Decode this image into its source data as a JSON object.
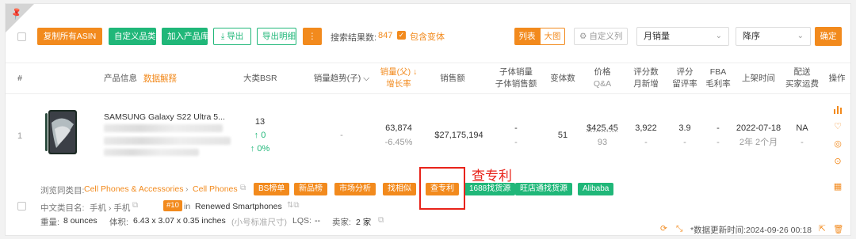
{
  "toolbar": {
    "copy_asin": "复制所有ASIN",
    "custom_category": "自定义品类",
    "add_to_library": "加入产品库",
    "export": "导出",
    "export_detail": "导出明细",
    "more": "⋮",
    "result_label": "搜索结果数:",
    "result_count": "847",
    "include_variants": "包含变体",
    "view_list": "列表",
    "view_grid": "大图",
    "custom_columns": "自定义列",
    "sort_field": "月销量",
    "sort_order": "降序",
    "confirm": "确定"
  },
  "headers": {
    "index": "#",
    "product_info": "产品信息",
    "data_explain": "数据解释",
    "bsr": "大类BSR",
    "sales_trend": "销量趋势(子)",
    "sales_parent_1": "销量(父)",
    "sales_parent_2": "增长率",
    "revenue": "销售额",
    "child_sales_1": "子体销量",
    "child_sales_2": "子体销售额",
    "variants": "变体数",
    "price_1": "价格",
    "price_2": "Q&A",
    "reviews_1": "评分数",
    "reviews_2": "月新增",
    "rating_1": "评分",
    "rating_2": "留评率",
    "fba_1": "FBA",
    "fba_2": "毛利率",
    "launch": "上架时间",
    "shipping_1": "配送",
    "shipping_2": "买家运费",
    "action": "操作"
  },
  "row": {
    "index": "1",
    "title": "SAMSUNG Galaxy S22 Ultra 5...",
    "bsr": "13",
    "bsr_change_1": "↑ 0",
    "bsr_change_2": "↑ 0%",
    "trend": "-",
    "sales": "63,874",
    "growth": "-6.45%",
    "revenue": "$27,175,194",
    "child_sales": "-",
    "child_revenue": "-",
    "variants": "51",
    "price": "$425.45",
    "qa": "93",
    "reviews": "3,922",
    "reviews_new": "-",
    "rating": "3.9",
    "review_rate": "-",
    "fba": "-",
    "margin": "-",
    "launch_date": "2022-07-18",
    "launch_age": "2年 2个月",
    "shipping": "NA",
    "buyer_fee": "-"
  },
  "browse": {
    "label": "浏览同类目:",
    "path_1": "Cell Phones & Accessories",
    "sep": "›",
    "path_2": "Cell Phones"
  },
  "tags": [
    "BS榜单",
    "新品榜",
    "市场分析",
    "找相似",
    "查专利",
    "1688找货源",
    "旺店通找货源",
    "Alibaba"
  ],
  "annotation": "查专利",
  "category_line": {
    "label": "中文类目名:",
    "value": "手机 › 手机",
    "rank": "#10",
    "in": "in",
    "category": "Renewed Smartphones"
  },
  "specs": {
    "weight_label": "重量:",
    "weight": "8 ounces",
    "volume_label": "体积:",
    "volume": "6.43 x 3.07 x 0.35 inches",
    "size_class": "(小号标准尺寸)",
    "lqs_label": "LQS:",
    "lqs": "--",
    "sellers_label": "卖家:",
    "sellers": "2 家"
  },
  "update_time": "*数据更新时间:2024-09-26 00:18"
}
